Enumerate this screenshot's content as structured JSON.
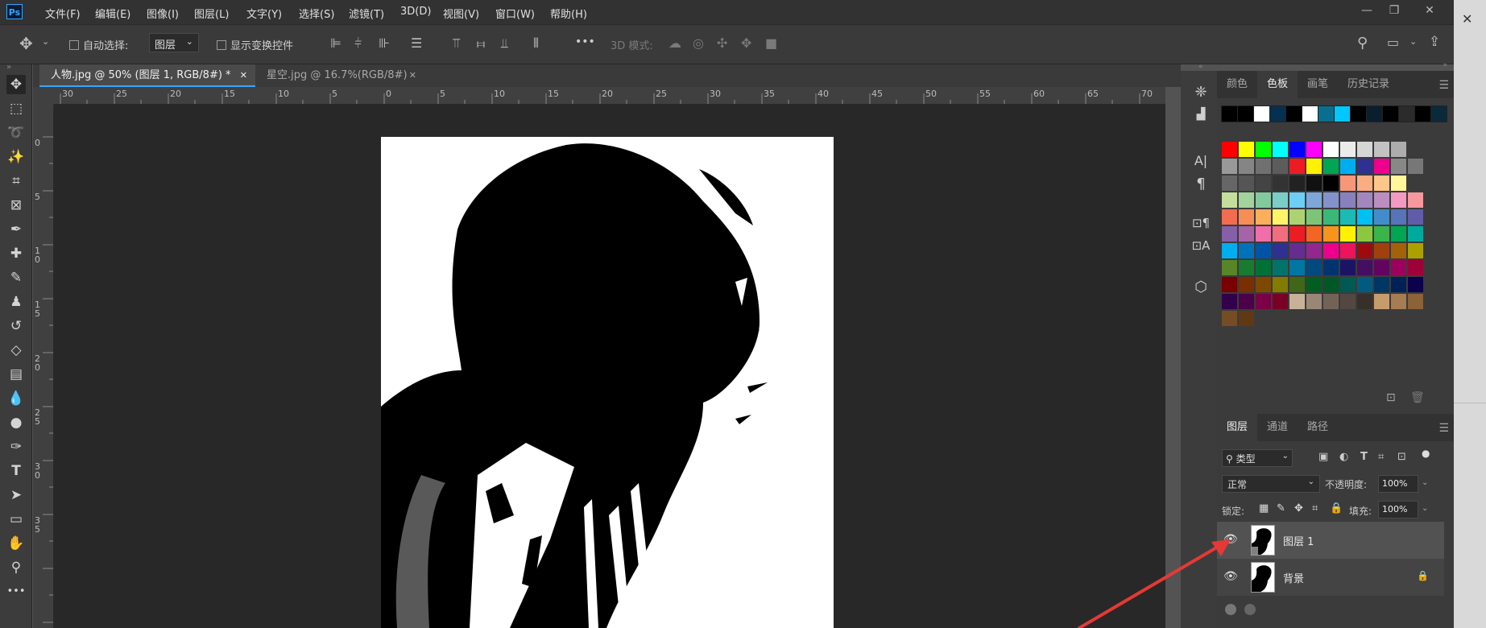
{
  "app": {
    "logo": "Ps"
  },
  "menu": [
    "文件(F)",
    "编辑(E)",
    "图像(I)",
    "图层(L)",
    "文字(Y)",
    "选择(S)",
    "滤镜(T)",
    "3D(D)",
    "视图(V)",
    "窗口(W)",
    "帮助(H)"
  ],
  "window_controls": {
    "minimize": "—",
    "restore": "❐",
    "close": "✕"
  },
  "options": {
    "auto_select_label": "自动选择:",
    "layer_dropdown": "图层",
    "show_transform_label": "显示变换控件",
    "mode_3d_label": "3D 模式:",
    "more": "•••"
  },
  "tabs": [
    {
      "label": "人物.jpg @ 50% (图层 1, RGB/8#) *",
      "close": "✕",
      "active": true
    },
    {
      "label": "星空.jpg @ 16.7%(RGB/8#)",
      "close": "✕",
      "active": false
    }
  ],
  "ruler": {
    "h_ticks": [
      "30",
      "25",
      "20",
      "15",
      "10",
      "5",
      "0",
      "5",
      "10",
      "15",
      "20",
      "25",
      "30",
      "35",
      "40",
      "45",
      "50",
      "55",
      "60",
      "65",
      "70"
    ],
    "v_ticks": [
      "0",
      "5",
      "1 0",
      "1 5",
      "2 0",
      "2 5",
      "3 0",
      "3 5"
    ]
  },
  "color_panel": {
    "tabs": [
      "颜色",
      "色板",
      "画笔",
      "历史记录"
    ],
    "active_tab": "色板",
    "recent_swatches": [
      "#000000",
      "#000000",
      "#ffffff",
      "#06304e",
      "#000000",
      "#ffffff",
      "#0a6f8e",
      "#00c8ff",
      "#000000",
      "#0a1f2e",
      "#000000",
      "#2b2b2b",
      "#000000",
      "#0a2a3a"
    ],
    "swatch_rows": [
      [
        "#ff0000",
        "#ffff00",
        "#00ff00",
        "#00ffff",
        "#0000ff",
        "#ff00ff",
        "#ffffff",
        "#ebebeb",
        "#d6d6d6",
        "#c2c2c2",
        "#adadad"
      ],
      [
        "#999999",
        "#858585",
        "#707070",
        "#5c5c5c",
        "#ed1c24",
        "#fff200",
        "#00a651",
        "#00aeef",
        "#2e3192",
        "#ec008c",
        "#888888",
        "#777777"
      ],
      [
        "#666666",
        "#555555",
        "#444444",
        "#333333",
        "#222222",
        "#111111",
        "#000000",
        "#f7977a",
        "#f9ad81",
        "#fdc68a",
        "#fff79a"
      ],
      [
        "#c4df9b",
        "#a3d39c",
        "#82ca9d",
        "#7bcdc8",
        "#6dcff6",
        "#7da7d9",
        "#8393ca",
        "#8781bd",
        "#a187be",
        "#bc8dbf",
        "#f49ac2",
        "#f6989d"
      ],
      [
        "#f26c4f",
        "#f68e55",
        "#fbaf5c",
        "#fff467",
        "#acd372",
        "#7cc576",
        "#3bb878",
        "#1abbb4",
        "#00bff3",
        "#438ccb",
        "#5574b9",
        "#605ca8"
      ],
      [
        "#855fa8",
        "#a763a8",
        "#f06ea9",
        "#f26d7d",
        "#ed1c24",
        "#f26522",
        "#f7941d",
        "#fff200",
        "#8dc73f",
        "#39b54a",
        "#00a651",
        "#00a99d"
      ],
      [
        "#00aeef",
        "#0072bc",
        "#0054a6",
        "#2e3192",
        "#662d91",
        "#92278f",
        "#ec008c",
        "#ed145b",
        "#9e0b0f",
        "#a0410d",
        "#a3620a",
        "#aba000"
      ],
      [
        "#598527",
        "#197b30",
        "#007236",
        "#00746b",
        "#0076a3",
        "#004a80",
        "#003471",
        "#1b1464",
        "#440e62",
        "#630460",
        "#9e005d",
        "#9e0039"
      ],
      [
        "#790000",
        "#7b2e00",
        "#7d4900",
        "#827b00",
        "#406618",
        "#005e20",
        "#005826",
        "#005952",
        "#005b7f",
        "#003663",
        "#002157",
        "#0d004c"
      ],
      [
        "#32004b",
        "#4b0049",
        "#7b0046",
        "#7a0026",
        "#c7b299",
        "#998675",
        "#736357",
        "#534741",
        "#37302a",
        "#c69c6d",
        "#a67c52",
        "#8c6239"
      ],
      [
        "#754c24",
        "#603913"
      ]
    ]
  },
  "layers_panel": {
    "tabs": [
      "图层",
      "通道",
      "路径"
    ],
    "active_tab": "图层",
    "filter_label": "类型",
    "blend_mode": "正常",
    "opacity_label": "不透明度:",
    "opacity_value": "100%",
    "lock_label": "锁定:",
    "fill_label": "填充:",
    "fill_value": "100%",
    "layers": [
      {
        "name": "图层 1",
        "selected": true,
        "locked": false
      },
      {
        "name": "背景",
        "selected": false,
        "locked": true
      }
    ]
  },
  "colors": {
    "annotation_arrow": "#e53935",
    "accent": "#31a8ff"
  }
}
